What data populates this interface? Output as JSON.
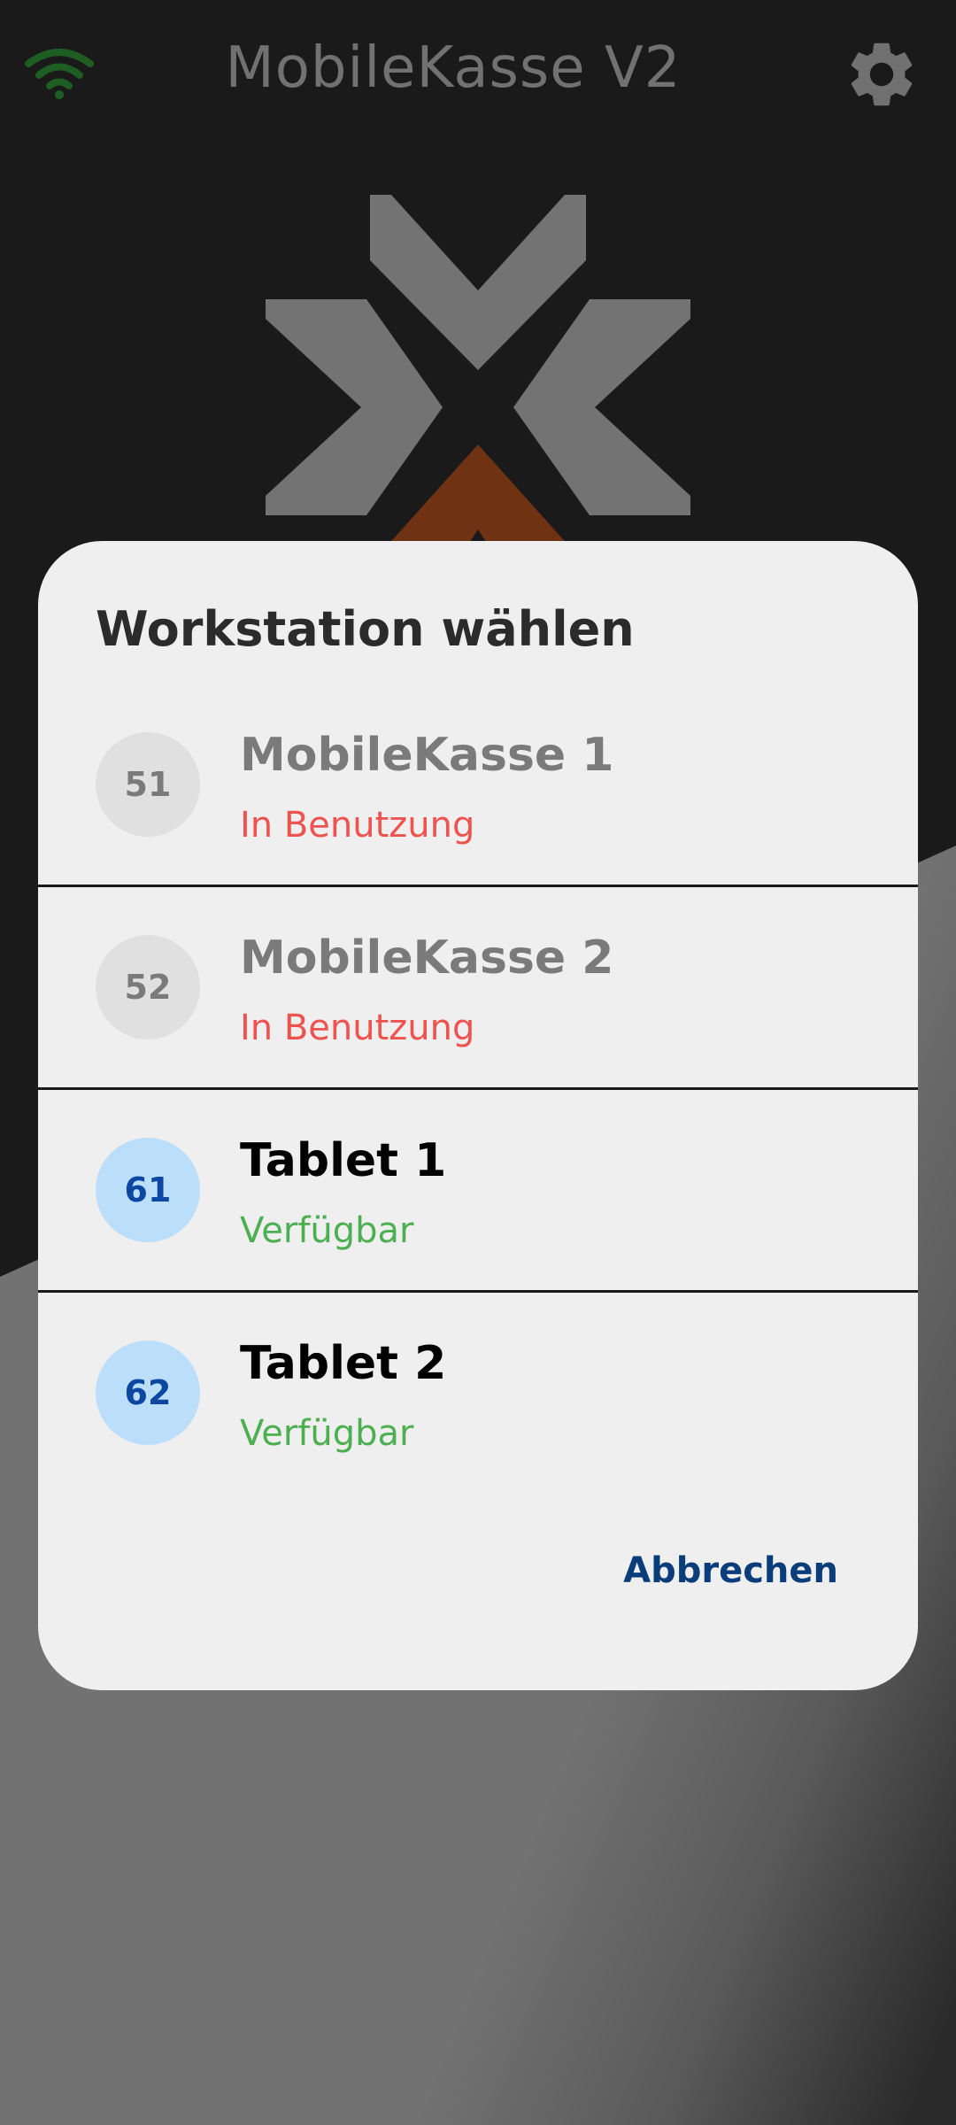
{
  "header": {
    "title": "MobileKasse V2",
    "wifi_icon": "wifi-icon",
    "settings_icon": "gear-icon"
  },
  "colors": {
    "background_dark": "#1a1a1a",
    "background_gray": "#727272",
    "wifi_green": "#1e5e22",
    "title_gray": "#717171",
    "logo_gray": "#737373",
    "logo_orange": "#6f3213",
    "dialog_bg": "#efefef",
    "unavailable_badge_bg": "#e0e0e0",
    "unavailable_text": "#7a7a7a",
    "status_in_use": "#ef5350",
    "available_badge_bg": "#bbdefb",
    "available_badge_text": "#0d47a1",
    "available_name": "#000000",
    "status_available": "#4caf50",
    "accent_blue": "#0b3d7a"
  },
  "dialog": {
    "title": "Workstation wählen",
    "cancel_label": "Abbrechen",
    "items": [
      {
        "number": "51",
        "name": "MobileKasse 1",
        "status": "In Benutzung",
        "available": false
      },
      {
        "number": "52",
        "name": "MobileKasse 2",
        "status": "In Benutzung",
        "available": false
      },
      {
        "number": "61",
        "name": "Tablet 1",
        "status": "Verfügbar",
        "available": true
      },
      {
        "number": "62",
        "name": "Tablet 2",
        "status": "Verfügbar",
        "available": true
      }
    ]
  }
}
